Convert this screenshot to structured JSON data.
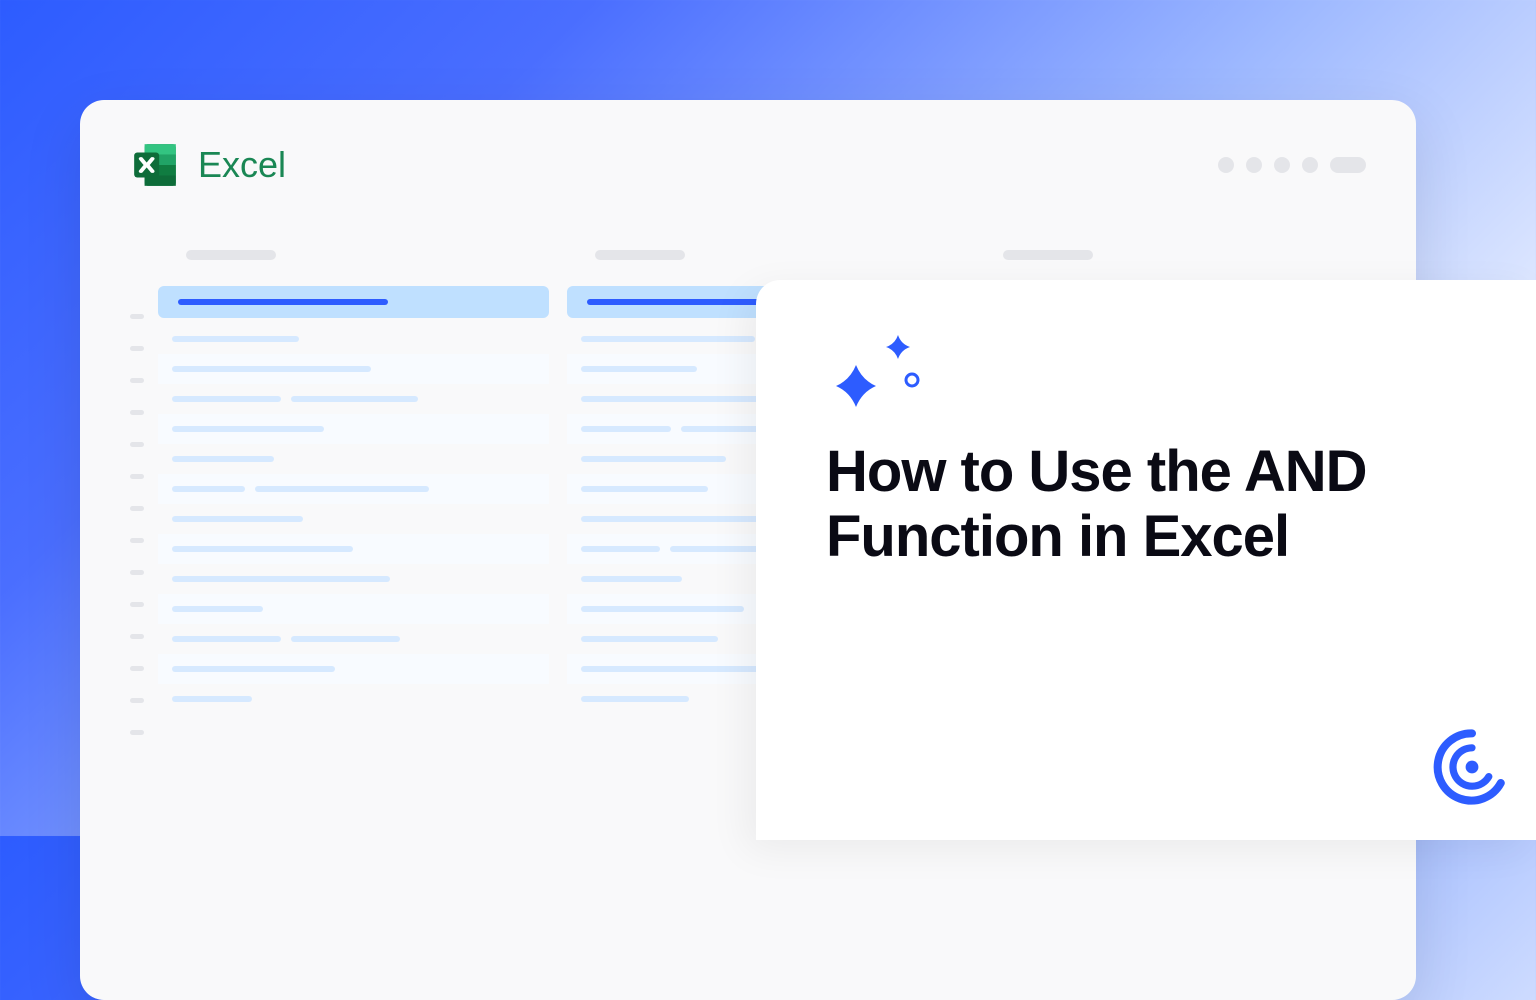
{
  "app": {
    "name": "Excel"
  },
  "icons": {
    "excel": "excel-icon",
    "sparkle": "sparkle-icon",
    "brand": "brand-c-icon"
  },
  "card": {
    "title": "How to Use the AND Function in Excel"
  },
  "colors": {
    "accent": "#2d5cff",
    "excel_green": "#1a8754"
  },
  "sheet": {
    "columns": 3,
    "rows": 12
  }
}
